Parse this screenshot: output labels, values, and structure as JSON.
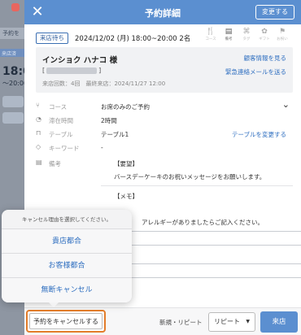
{
  "background": {
    "tab1_label": "予約を",
    "tab3_label": "来店済",
    "time_big": "18:00",
    "time_sub": "～20:00"
  },
  "modal": {
    "title": "予約詳細",
    "change_button": "変更する",
    "status_badge": "来店待ち",
    "date_line": "2024/12/02 (月) 18:00~20:00 2名",
    "tool_icons": [
      {
        "icon": "fork-icon",
        "glyph": "🍴",
        "label": "コース"
      },
      {
        "icon": "memo-icon",
        "glyph": "▤",
        "label": "備考"
      },
      {
        "icon": "tag-icon",
        "glyph": "⌘",
        "label": "タグ"
      },
      {
        "icon": "gift-icon",
        "glyph": "✿",
        "label": "ギフト"
      },
      {
        "icon": "flag-icon",
        "glyph": "⚑",
        "label": "お祝い"
      }
    ],
    "guest": {
      "name": "インショク ハナコ 様",
      "phone_prefix": "[",
      "phone_suffix": "]",
      "visits": "来店回数：4回　最終来店：2024/11/27 12:00",
      "link_info": "顧客情報を見る",
      "link_email": "緊急連絡メールを送る"
    },
    "fields": {
      "course_label": "コース",
      "course_value": "お席のみのご予約",
      "stay_label": "滞在時間",
      "stay_value": "2時間",
      "table_label": "テーブル",
      "table_value": "テーブル1",
      "table_link": "テーブルを変更する",
      "keyword_label": "キーワード",
      "keyword_value": "-",
      "notes_label": "備考"
    },
    "notes": {
      "request_heading": "【要望】",
      "request_text": "バースデーケーキのお祝いメッセージをお願いします。",
      "memo_heading": "【メモ】",
      "allergy_text": "アレルギーがありましたらご記入ください。"
    }
  },
  "footer": {
    "cancel_button": "予約をキャンセルする",
    "new_repeat_label": "新規・リピート",
    "repeat_select": "リピート",
    "arrive_button": "来店"
  },
  "popover": {
    "title": "キャンセル理由を選択してください。",
    "options": [
      "貴店都合",
      "お客様都合",
      "無断キャンセル"
    ]
  },
  "colors": {
    "header_blue": "#5b8fd0",
    "link_blue": "#2f6fc0",
    "highlight_orange": "#e37d2b"
  }
}
